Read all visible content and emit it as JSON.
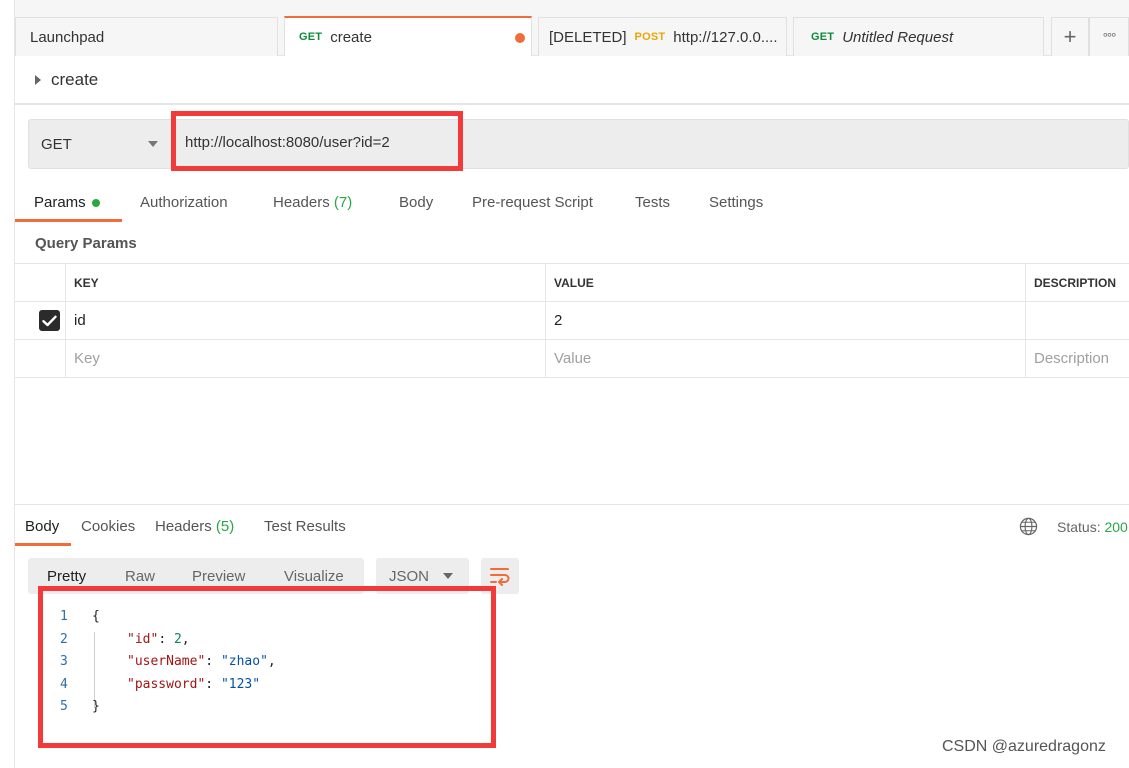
{
  "tabs": [
    {
      "label": "Launchpad"
    },
    {
      "method": "GET",
      "label": "create"
    },
    {
      "prefix": "[DELETED]",
      "method": "POST",
      "label": "http://127.0.0...."
    },
    {
      "method": "GET",
      "label": "Untitled Request"
    }
  ],
  "tab_actions": {
    "add": "+",
    "more": "°°°"
  },
  "request": {
    "name": "create",
    "method": "GET",
    "url": "http://localhost:8080/user?id=2"
  },
  "request_tabs": {
    "params": "Params",
    "authorization": "Authorization",
    "headers": "Headers",
    "headers_count": "(7)",
    "body": "Body",
    "prerequest": "Pre-request Script",
    "tests": "Tests",
    "settings": "Settings"
  },
  "query_params": {
    "label": "Query Params",
    "columns": [
      "KEY",
      "VALUE",
      "DESCRIPTION"
    ],
    "rows": [
      {
        "key": "id",
        "value": "2",
        "checked": true
      }
    ],
    "placeholders": {
      "key": "Key",
      "value": "Value",
      "description": "Description"
    }
  },
  "response": {
    "tabs": {
      "body": "Body",
      "cookies": "Cookies",
      "headers": "Headers",
      "headers_count": "(5)",
      "test_results": "Test Results"
    },
    "status_label": "Status:",
    "status_value": "200",
    "formats": [
      "Pretty",
      "Raw",
      "Preview",
      "Visualize"
    ],
    "language": "JSON",
    "lines": [
      {
        "n": "1",
        "text": "{"
      },
      {
        "n": "2",
        "key": "\"id\"",
        "sep": ": ",
        "val": "2",
        "end": ","
      },
      {
        "n": "3",
        "key": "\"userName\"",
        "sep": ": ",
        "val": "\"zhao\"",
        "end": ","
      },
      {
        "n": "4",
        "key": "\"password\"",
        "sep": ": ",
        "val": "\"123\"",
        "end": ""
      },
      {
        "n": "5",
        "text": "}"
      }
    ]
  },
  "watermark": "CSDN @azuredragonz",
  "colors": {
    "accent": "#f26b3a",
    "get": "#0f8a3c",
    "post": "#e8a703",
    "highlight": "#f23a3a",
    "success": "#28a745"
  }
}
